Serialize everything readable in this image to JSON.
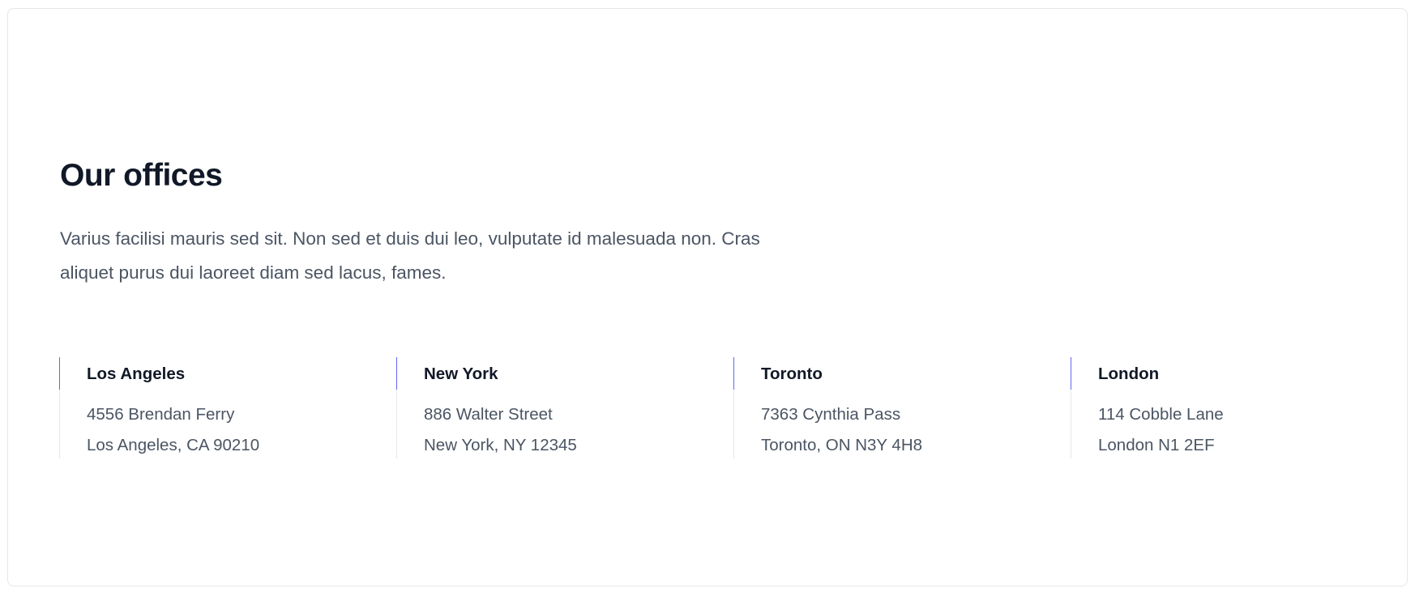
{
  "section": {
    "title": "Our offices",
    "description": "Varius facilisi mauris sed sit. Non sed et duis dui leo, vulputate id malesuada non. Cras aliquet purus dui laoreet diam sed lacus, fames."
  },
  "colors": {
    "accent": "#6366f1",
    "heading": "#111827",
    "body_text": "#4b5563",
    "divider": "#e5e7eb"
  },
  "offices": [
    {
      "name": "Los Angeles",
      "address_line1": "4556 Brendan Ferry",
      "address_line2": "Los Angeles, CA 90210"
    },
    {
      "name": "New York",
      "address_line1": "886 Walter Street",
      "address_line2": "New York, NY 12345"
    },
    {
      "name": "Toronto",
      "address_line1": "7363 Cynthia Pass",
      "address_line2": "Toronto, ON N3Y 4H8"
    },
    {
      "name": "London",
      "address_line1": "114 Cobble Lane",
      "address_line2": "London N1 2EF"
    }
  ]
}
